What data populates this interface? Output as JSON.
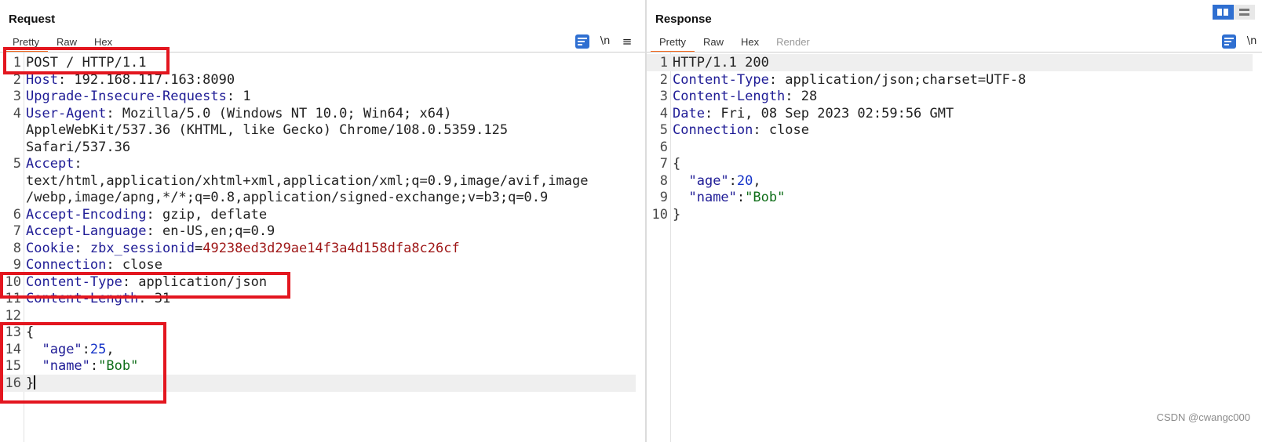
{
  "request": {
    "title": "Request",
    "tabs": [
      "Pretty",
      "Raw",
      "Hex"
    ],
    "icons": [
      "wrap-lines-icon",
      "newline-icon",
      "menu-icon"
    ],
    "newline_label": "\\n",
    "menu_glyph": "≡",
    "lines": [
      {
        "n": "1",
        "parts": [
          {
            "t": "POST / HTTP/1.1",
            "c": ""
          }
        ]
      },
      {
        "n": "2",
        "parts": [
          {
            "t": "Host",
            "c": "k"
          },
          {
            "t": ": 192.168.117.163:8090",
            "c": ""
          }
        ]
      },
      {
        "n": "3",
        "parts": [
          {
            "t": "Upgrade-Insecure-Requests",
            "c": "k"
          },
          {
            "t": ": 1",
            "c": ""
          }
        ]
      },
      {
        "n": "4",
        "parts": [
          {
            "t": "User-Agent",
            "c": "k"
          },
          {
            "t": ": Mozilla/5.0 (Windows NT 10.0; Win64; x64)",
            "c": ""
          }
        ]
      },
      {
        "n": "",
        "parts": [
          {
            "t": "AppleWebKit/537.36 (KHTML, like Gecko) Chrome/108.0.5359.125",
            "c": ""
          }
        ]
      },
      {
        "n": "",
        "parts": [
          {
            "t": "Safari/537.36",
            "c": ""
          }
        ]
      },
      {
        "n": "5",
        "parts": [
          {
            "t": "Accept",
            "c": "k"
          },
          {
            "t": ":",
            "c": ""
          }
        ]
      },
      {
        "n": "",
        "parts": [
          {
            "t": "text/html,application/xhtml+xml,application/xml;q=0.9,image/avif,image",
            "c": ""
          }
        ]
      },
      {
        "n": "",
        "parts": [
          {
            "t": "/webp,image/apng,*/*;q=0.8,application/signed-exchange;v=b3;q=0.9",
            "c": ""
          }
        ]
      },
      {
        "n": "6",
        "parts": [
          {
            "t": "Accept-Encoding",
            "c": "k"
          },
          {
            "t": ": gzip, deflate",
            "c": ""
          }
        ]
      },
      {
        "n": "7",
        "parts": [
          {
            "t": "Accept-Language",
            "c": "k"
          },
          {
            "t": ": en-US,en;q=0.9",
            "c": ""
          }
        ]
      },
      {
        "n": "8",
        "parts": [
          {
            "t": "Cookie",
            "c": "k"
          },
          {
            "t": ": ",
            "c": ""
          },
          {
            "t": "zbx_sessionid",
            "c": "k"
          },
          {
            "t": "=",
            "c": ""
          },
          {
            "t": "49238ed3d29ae14f3a4d158dfa8c26cf",
            "c": "cv"
          }
        ]
      },
      {
        "n": "9",
        "parts": [
          {
            "t": "Connection",
            "c": "k"
          },
          {
            "t": ": close",
            "c": ""
          }
        ]
      },
      {
        "n": "10",
        "parts": [
          {
            "t": "Content-Type",
            "c": "k"
          },
          {
            "t": ": application/json",
            "c": ""
          }
        ]
      },
      {
        "n": "11",
        "parts": [
          {
            "t": "Content-Length",
            "c": "k"
          },
          {
            "t": ": 31",
            "c": ""
          }
        ]
      },
      {
        "n": "12",
        "parts": []
      },
      {
        "n": "13",
        "parts": [
          {
            "t": "{",
            "c": ""
          }
        ]
      },
      {
        "n": "14",
        "parts": [
          {
            "t": "  ",
            "c": ""
          },
          {
            "t": "\"age\"",
            "c": "k"
          },
          {
            "t": ":",
            "c": ""
          },
          {
            "t": "25",
            "c": "n"
          },
          {
            "t": ",",
            "c": ""
          }
        ]
      },
      {
        "n": "15",
        "parts": [
          {
            "t": "  ",
            "c": ""
          },
          {
            "t": "\"name\"",
            "c": "k"
          },
          {
            "t": ":",
            "c": ""
          },
          {
            "t": "\"Bob\"",
            "c": "s"
          }
        ]
      },
      {
        "n": "16",
        "parts": [
          {
            "t": "}",
            "c": ""
          }
        ],
        "cursor": true
      }
    ]
  },
  "response": {
    "title": "Response",
    "tabs": [
      "Pretty",
      "Raw",
      "Hex",
      "Render"
    ],
    "icons": [
      "wrap-lines-icon",
      "newline-icon"
    ],
    "newline_label": "\\n",
    "lines": [
      {
        "n": "1",
        "parts": [
          {
            "t": "HTTP/1.1 200",
            "c": ""
          }
        ]
      },
      {
        "n": "2",
        "parts": [
          {
            "t": "Content-Type",
            "c": "k"
          },
          {
            "t": ": application/json;charset=UTF-8",
            "c": ""
          }
        ]
      },
      {
        "n": "3",
        "parts": [
          {
            "t": "Content-Length",
            "c": "k"
          },
          {
            "t": ": 28",
            "c": ""
          }
        ]
      },
      {
        "n": "4",
        "parts": [
          {
            "t": "Date",
            "c": "k"
          },
          {
            "t": ": Fri, 08 Sep 2023 02:59:56 GMT",
            "c": ""
          }
        ]
      },
      {
        "n": "5",
        "parts": [
          {
            "t": "Connection",
            "c": "k"
          },
          {
            "t": ": close",
            "c": ""
          }
        ]
      },
      {
        "n": "6",
        "parts": []
      },
      {
        "n": "7",
        "parts": [
          {
            "t": "{",
            "c": ""
          }
        ]
      },
      {
        "n": "8",
        "parts": [
          {
            "t": "  ",
            "c": ""
          },
          {
            "t": "\"age\"",
            "c": "k"
          },
          {
            "t": ":",
            "c": ""
          },
          {
            "t": "20",
            "c": "n"
          },
          {
            "t": ",",
            "c": ""
          }
        ]
      },
      {
        "n": "9",
        "parts": [
          {
            "t": "  ",
            "c": ""
          },
          {
            "t": "\"name\"",
            "c": "k"
          },
          {
            "t": ":",
            "c": ""
          },
          {
            "t": "\"Bob\"",
            "c": "s"
          }
        ]
      },
      {
        "n": "10",
        "parts": [
          {
            "t": "}",
            "c": ""
          }
        ]
      }
    ]
  },
  "watermark": "CSDN @cwangc000",
  "colors": {
    "accent_tab": "#f26a21",
    "icon_blue": "#2f6fd1",
    "annotation_red": "#e3161f",
    "header_key": "#1f1c96",
    "json_string": "#0f6e19",
    "json_number": "#1533c8",
    "cookie_value": "#9e1616"
  }
}
